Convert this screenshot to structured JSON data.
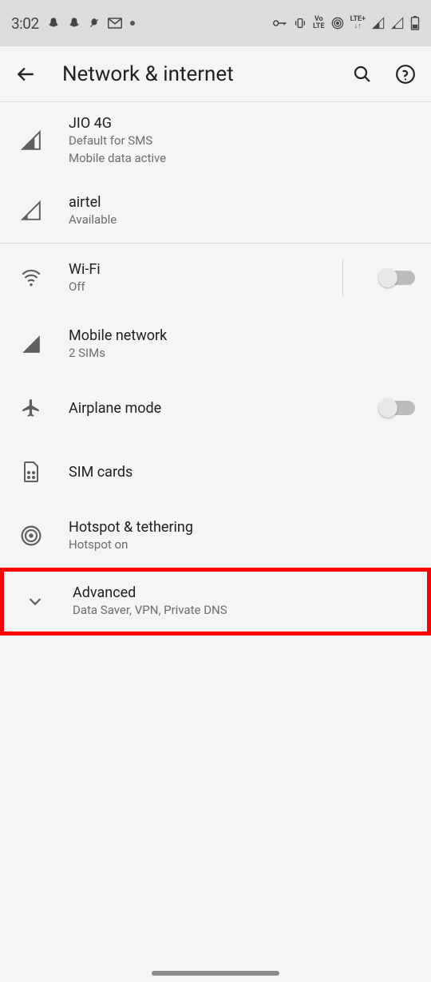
{
  "statusbar": {
    "time": "3:02",
    "left_icons": [
      "snapchat",
      "snapchat",
      "dnd",
      "gmail",
      "dot"
    ],
    "right_icons": [
      "key",
      "vibrate",
      "volte",
      "hotspot",
      "lte",
      "signal",
      "signal",
      "battery"
    ]
  },
  "appbar": {
    "title": "Network & internet"
  },
  "sim_rows": [
    {
      "title": "JIO 4G",
      "line1": "Default for SMS",
      "line2": "Mobile data active"
    },
    {
      "title": "airtel",
      "line1": "Available",
      "line2": ""
    }
  ],
  "items": {
    "wifi": {
      "title": "Wi-Fi",
      "sub": "Off"
    },
    "mobile": {
      "title": "Mobile network",
      "sub": "2 SIMs"
    },
    "airplane": {
      "title": "Airplane mode"
    },
    "sim": {
      "title": "SIM cards"
    },
    "hotspot": {
      "title": "Hotspot & tethering",
      "sub": "Hotspot on"
    },
    "advanced": {
      "title": "Advanced",
      "sub": "Data Saver, VPN, Private DNS"
    }
  }
}
